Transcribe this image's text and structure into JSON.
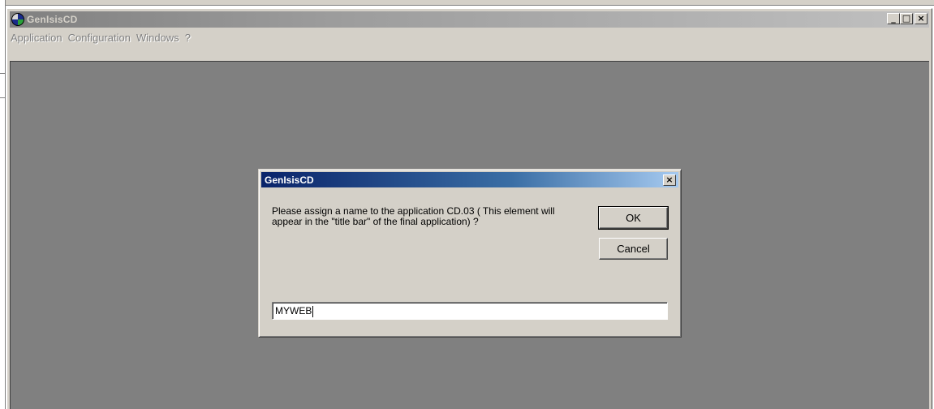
{
  "main_window": {
    "title": "GenIsisCD",
    "icon": "cd-disc-icon",
    "controls": {
      "minimize": "_",
      "maximize": "□",
      "close": "×"
    }
  },
  "menubar": {
    "items": [
      "Application",
      "Configuration",
      "Windows",
      "?"
    ]
  },
  "dialog": {
    "title": "GenIsisCD",
    "close": "×",
    "message": "Please assign a name to the application CD.03 ( This element will appear in the \"title bar\" of the final application) ?",
    "ok_label": "OK",
    "cancel_label": "Cancel",
    "input_value": "MYWEB"
  },
  "colors": {
    "dialog_title_start": "#0a246a",
    "dialog_title_end": "#a6caf0",
    "inactive_title": "#808080",
    "client_area": "#808080",
    "face": "#d4d0c8"
  }
}
